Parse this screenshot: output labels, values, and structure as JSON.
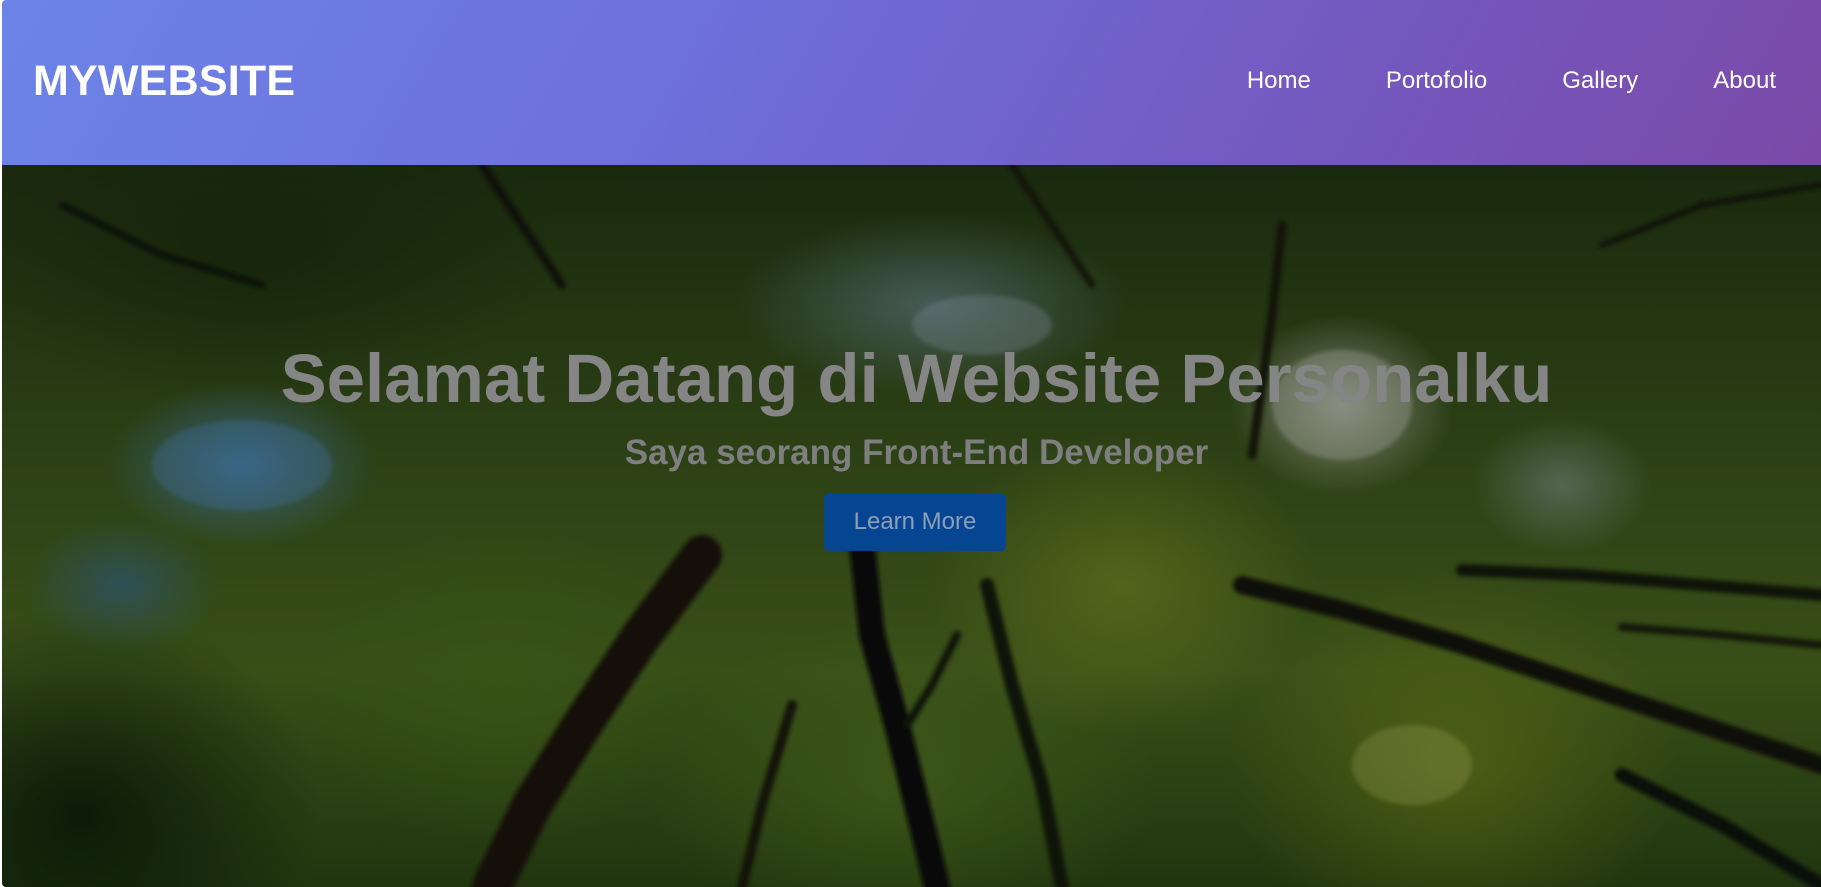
{
  "header": {
    "logo": "MYWEBSITE",
    "nav": [
      {
        "label": "Home"
      },
      {
        "label": "Portofolio"
      },
      {
        "label": "Gallery"
      },
      {
        "label": "About"
      }
    ],
    "gradient_colors": [
      "#6c84e8",
      "#7b4aa8"
    ]
  },
  "hero": {
    "title": "Selamat Datang di Website Personalku",
    "subtitle": "Saya seorang Front-End Developer",
    "button_label": "Learn More",
    "button_color": "#064592",
    "background": "forest-canopy-photo"
  }
}
